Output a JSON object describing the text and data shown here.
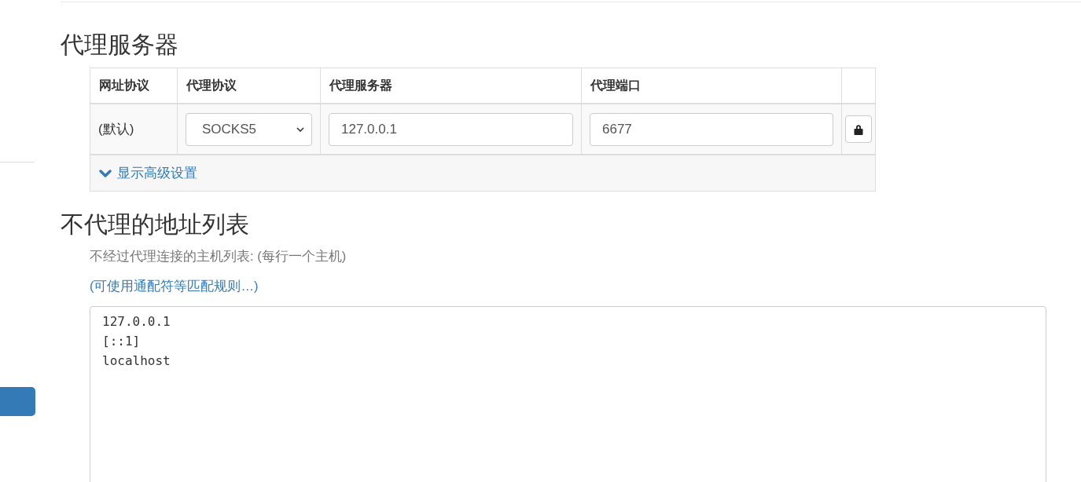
{
  "proxy_section": {
    "title": "代理服务器",
    "table": {
      "columns": [
        "网址协议",
        "代理协议",
        "代理服务器",
        "代理端口"
      ],
      "rows": [
        {
          "url_scheme": "(默认)",
          "proxy_protocol": "SOCKS5",
          "proxy_server": "127.0.0.1",
          "proxy_port": "6677"
        }
      ],
      "advanced_link": "显示高级设置"
    }
  },
  "bypass_section": {
    "title": "不代理的地址列表",
    "description": "不经过代理连接的主机列表: (每行一个主机)",
    "help_link": "(可使用通配符等匹配规则…)",
    "hosts": [
      "127.0.0.1",
      "[::1]",
      "localhost"
    ]
  }
}
